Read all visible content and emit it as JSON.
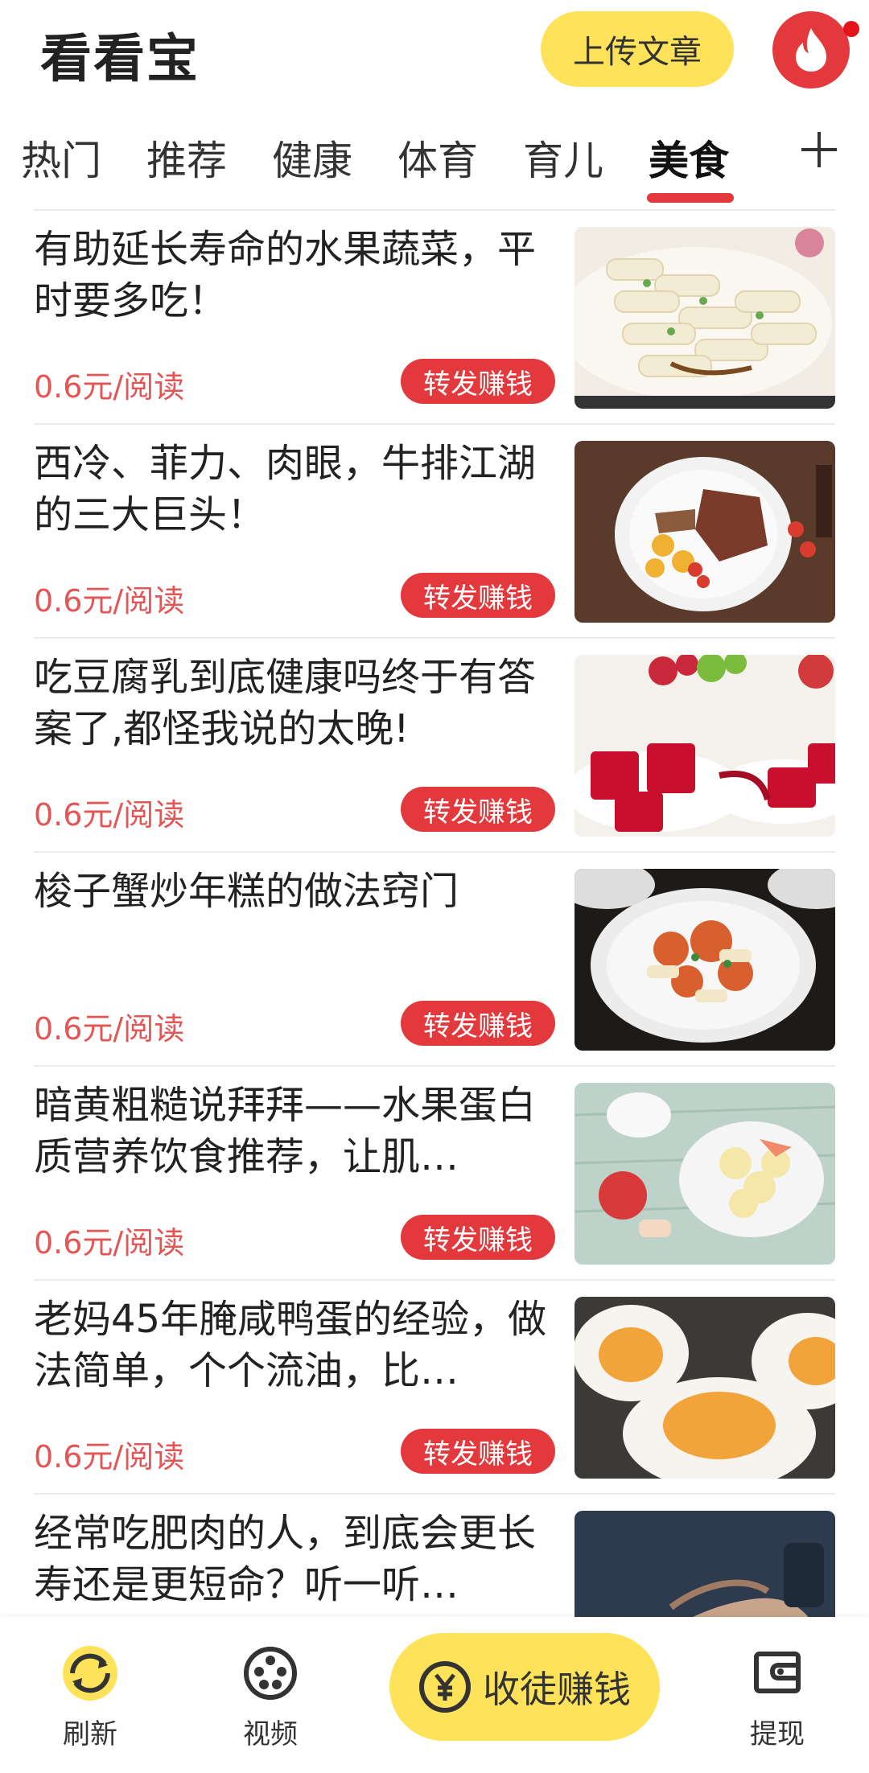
{
  "app": {
    "title": "看看宝",
    "upload_label": "上传文章"
  },
  "tabs": [
    "热门",
    "推荐",
    "健康",
    "体育",
    "育儿",
    "美食"
  ],
  "active_tab": "美食",
  "feed": {
    "items": [
      {
        "title": "有助延长寿命的水果蔬菜，平时要多吃！",
        "price": "0.6元/阅读",
        "share_label": "转发赚钱",
        "thumb": "rice-cakes-icon"
      },
      {
        "title": "西冷、菲力、肉眼，牛排江湖的三大巨头！",
        "price": "0.6元/阅读",
        "share_label": "转发赚钱",
        "thumb": "steak-plate-icon"
      },
      {
        "title": "吃豆腐乳到底健康吗终于有答案了,都怪我说的太晚!",
        "price": "0.6元/阅读",
        "share_label": "转发赚钱",
        "thumb": "red-tofu-icon"
      },
      {
        "title": "梭子蟹炒年糕的做法窍门",
        "price": "0.6元/阅读",
        "share_label": "转发赚钱",
        "thumb": "crab-rice-cake-icon"
      },
      {
        "title": "暗黄粗糙说拜拜——水果蛋白质营养饮食推荐，让肌…",
        "price": "0.6元/阅读",
        "share_label": "转发赚钱",
        "thumb": "fruit-salad-icon"
      },
      {
        "title": "老妈45年腌咸鸭蛋的经验，做法简单，个个流油，比…",
        "price": "0.6元/阅读",
        "share_label": "转发赚钱",
        "thumb": "salted-egg-icon"
      },
      {
        "title": "经常吃肥肉的人，到底会更长寿还是更短命？听一听…",
        "price": "",
        "share_label": "",
        "thumb": "elderly-hands-icon"
      }
    ]
  },
  "bottom_nav": {
    "refresh_label": "刷新",
    "video_label": "视频",
    "recruit_label": "收徒赚钱",
    "withdraw_label": "提现"
  },
  "colors": {
    "accent_red": "#e4393c",
    "accent_yellow": "#fde25a",
    "price_red": "#e25656"
  }
}
